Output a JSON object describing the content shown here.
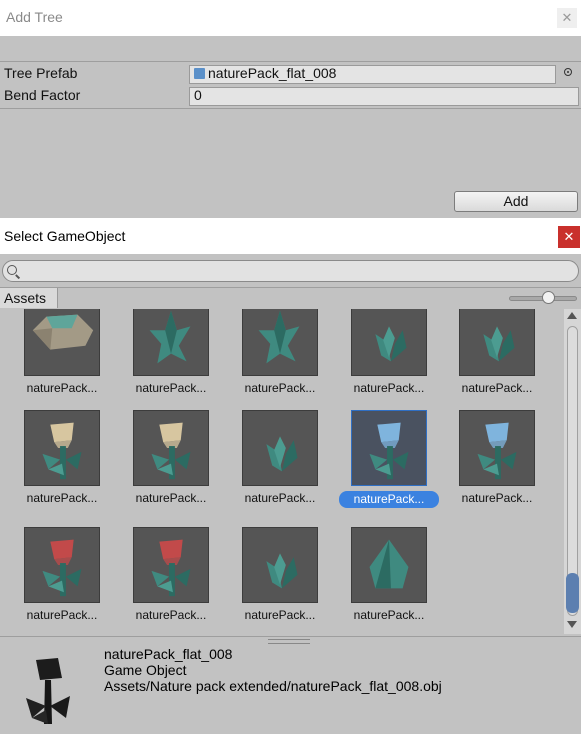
{
  "add_tree": {
    "title": "Add Tree",
    "close_glyph": "✕",
    "tree_prefab_label": "Tree Prefab",
    "tree_prefab_value": "naturePack_flat_008",
    "bend_factor_label": "Bend Factor",
    "bend_factor_value": "0",
    "add_label": "Add"
  },
  "selector": {
    "title": "Select GameObject",
    "close_glyph": "✕",
    "search_value": "",
    "tab_label": "Assets",
    "icon_size": 0.55,
    "items": [
      {
        "label": "naturePack...",
        "icon": "rock-mesh-icon"
      },
      {
        "label": "naturePack...",
        "icon": "grass-mesh-icon"
      },
      {
        "label": "naturePack...",
        "icon": "grass-mesh-icon"
      },
      {
        "label": "naturePack...",
        "icon": "plant-mesh-icon"
      },
      {
        "label": "naturePack...",
        "icon": "plant-mesh-icon"
      },
      {
        "label": "naturePack...",
        "icon": "flower-mesh-icon"
      },
      {
        "label": "naturePack...",
        "icon": "flower-mesh-icon"
      },
      {
        "label": "naturePack...",
        "icon": "plant-mesh-icon"
      },
      {
        "label": "naturePack...",
        "icon": "flower-mesh-icon",
        "selected": true
      },
      {
        "label": "naturePack...",
        "icon": "flower-mesh-icon"
      },
      {
        "label": "naturePack...",
        "icon": "flower-mesh-icon"
      },
      {
        "label": "naturePack...",
        "icon": "flower-mesh-icon"
      },
      {
        "label": "naturePack...",
        "icon": "plant-mesh-icon"
      },
      {
        "label": "naturePack...",
        "icon": "bush-mesh-icon"
      }
    ],
    "scroll_position": 0.92
  },
  "preview": {
    "name": "naturePack_flat_008",
    "type": "Game Object",
    "path": "Assets/Nature pack extended/naturePack_flat_008.obj"
  },
  "colors": {
    "foliage": "#3f8a80",
    "foliage_dark": "#2c6b62",
    "petal_beige": "#d7c6a0",
    "petal_blue": "#7fb4dd",
    "petal_red": "#c24a4a",
    "rock": "#a39a86",
    "selection": "#3b82e0"
  }
}
